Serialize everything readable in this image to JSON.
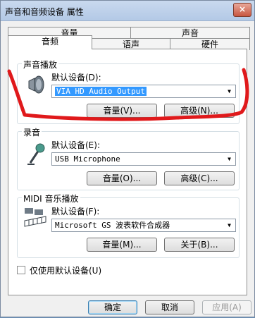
{
  "window": {
    "title": "声音和音频设备 属性",
    "close_label": "×"
  },
  "tabs": {
    "row_back": [
      "音量",
      "声音"
    ],
    "row_front": [
      "音频",
      "语声",
      "硬件"
    ],
    "active": "音频"
  },
  "playback": {
    "group_title": "声音播放",
    "default_device_label": "默认设备(D):",
    "device_value": "VIA HD Audio Output",
    "volume_button": "音量(V)...",
    "advanced_button": "高级(N)..."
  },
  "recording": {
    "group_title": "录音",
    "default_device_label": "默认设备(E):",
    "device_value": "USB Microphone",
    "volume_button": "音量(O)...",
    "advanced_button": "高级(C)..."
  },
  "midi": {
    "group_title": "MIDI 音乐播放",
    "default_device_label": "默认设备(F):",
    "device_value": "Microsoft GS 波表软件合成器",
    "volume_button": "音量(M)...",
    "about_button": "关于(B)..."
  },
  "use_default_only": {
    "label": "仅使用默认设备(U)",
    "checked": false
  },
  "footer": {
    "ok": "确定",
    "cancel": "取消",
    "apply": "应用(A)"
  },
  "icons": {
    "speaker": "speaker-icon",
    "microphone": "microphone-icon",
    "midi": "midi-keyboard-icon",
    "dropdown": "chevron-down-icon"
  },
  "colors": {
    "annotation": "#e0191b",
    "selection": "#3399ff"
  }
}
